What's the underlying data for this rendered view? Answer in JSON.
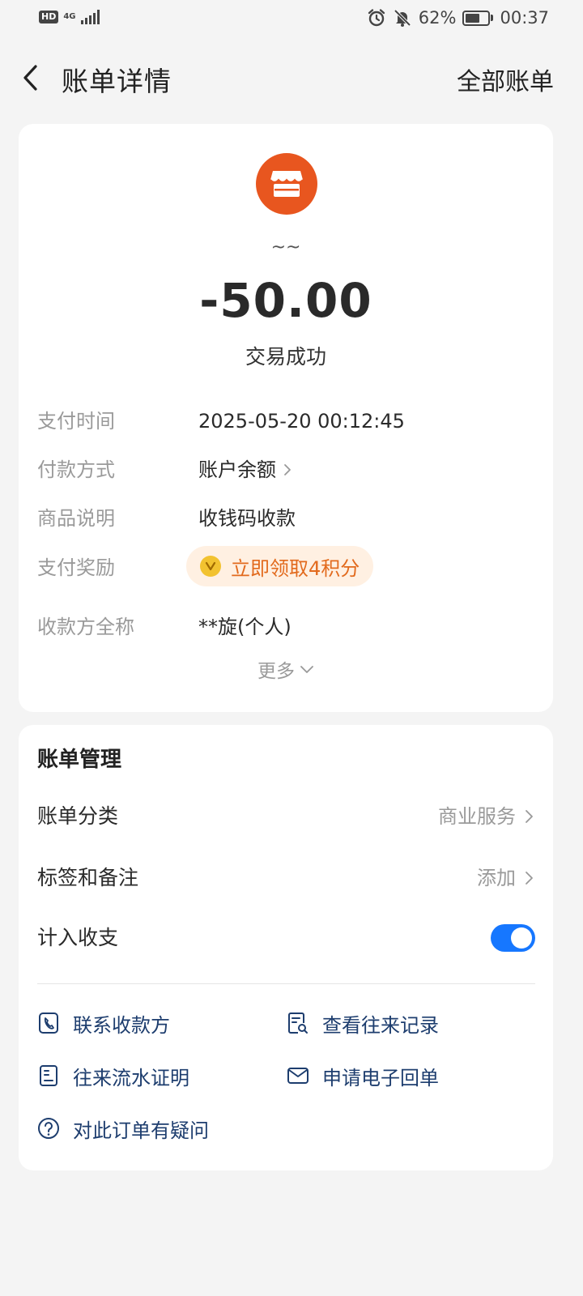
{
  "status_bar": {
    "hd": "HD",
    "network": "4G",
    "battery_percent": "62%",
    "battery_level": 0.62,
    "time": "00:37",
    "icons": [
      "alarm-icon",
      "bell-off-icon",
      "battery-icon"
    ]
  },
  "nav": {
    "title": "账单详情",
    "right_label": "全部账单"
  },
  "transaction": {
    "merchant_icon": "shop-icon",
    "merchant_name": "~~",
    "amount": "-50.00",
    "status": "交易成功"
  },
  "details": {
    "pay_time_label": "支付时间",
    "pay_time_value": "2025-05-20 00:12:45",
    "method_label": "付款方式",
    "method_value": "账户余额",
    "desc_label": "商品说明",
    "desc_value": "收钱码收款",
    "reward_label": "支付奖励",
    "reward_value": "立即领取4积分",
    "payee_label": "收款方全称",
    "payee_value": "**旋(个人)",
    "more_label": "更多"
  },
  "management": {
    "title": "账单管理",
    "category_label": "账单分类",
    "category_value": "商业服务",
    "tags_label": "标签和备注",
    "tags_value": "添加",
    "count_label": "计入收支",
    "count_enabled": true
  },
  "actions": {
    "contact_payee": "联系收款方",
    "view_history": "查看往来记录",
    "flow_proof": "往来流水证明",
    "e_receipt": "申请电子回单",
    "question": "对此订单有疑问"
  },
  "colors": {
    "accent": "#1677ff",
    "merchant": "#e8561f",
    "reward_text": "#e26a1d",
    "reward_bg": "#fff0e2",
    "action_text": "#1d3d6e"
  }
}
